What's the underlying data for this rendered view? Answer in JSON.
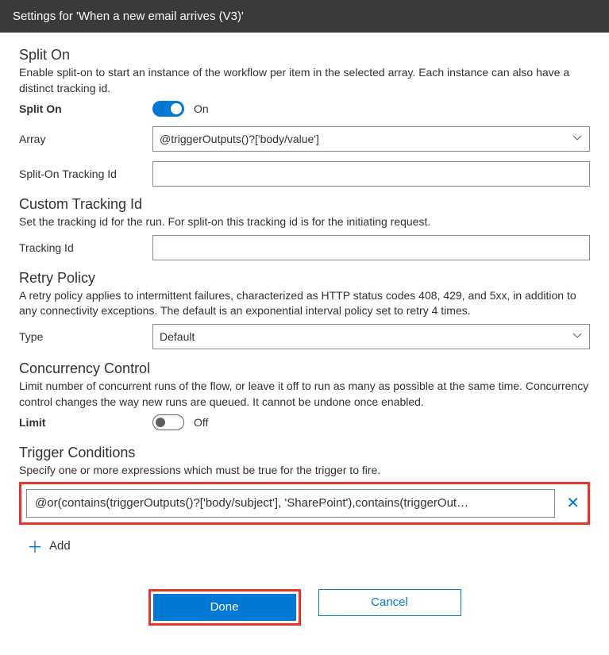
{
  "header": {
    "title": "Settings for 'When a new email arrives (V3)'"
  },
  "splitOn": {
    "title": "Split On",
    "desc": "Enable split-on to start an instance of the workflow per item in the selected array. Each instance can also have a distinct tracking id.",
    "toggleLabel": "Split On",
    "toggleState": "On",
    "arrayLabel": "Array",
    "arrayValue": "@triggerOutputs()?['body/value']",
    "trackingIdLabel": "Split-On Tracking Id",
    "trackingIdValue": ""
  },
  "customTracking": {
    "title": "Custom Tracking Id",
    "desc": "Set the tracking id for the run. For split-on this tracking id is for the initiating request.",
    "label": "Tracking Id",
    "value": ""
  },
  "retry": {
    "title": "Retry Policy",
    "desc": "A retry policy applies to intermittent failures, characterized as HTTP status codes 408, 429, and 5xx, in addition to any connectivity exceptions. The default is an exponential interval policy set to retry 4 times.",
    "typeLabel": "Type",
    "typeValue": "Default"
  },
  "concurrency": {
    "title": "Concurrency Control",
    "desc": "Limit number of concurrent runs of the flow, or leave it off to run as many as possible at the same time. Concurrency control changes the way new runs are queued. It cannot be undone once enabled.",
    "limitLabel": "Limit",
    "limitState": "Off"
  },
  "trigger": {
    "title": "Trigger Conditions",
    "desc": "Specify one or more expressions which must be true for the trigger to fire.",
    "condition": "@or(contains(triggerOutputs()?['body/subject'], 'SharePoint'),contains(triggerOut…",
    "addLabel": "Add"
  },
  "footer": {
    "done": "Done",
    "cancel": "Cancel"
  }
}
